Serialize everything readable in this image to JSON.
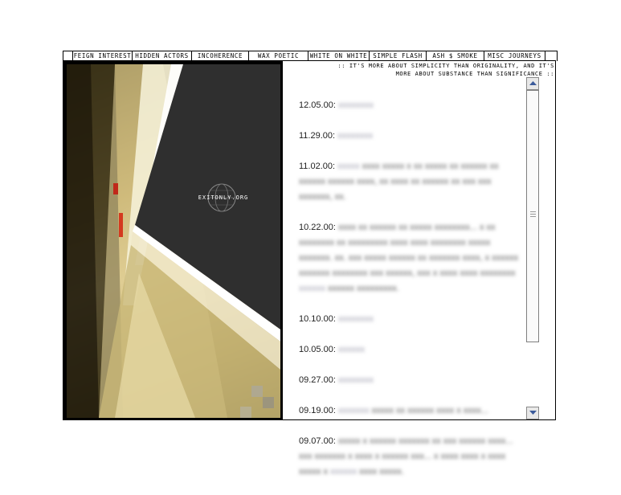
{
  "nav": {
    "tabs": [
      {
        "label": "FEIGN INTEREST"
      },
      {
        "label": "HIDDEN ACTORS"
      },
      {
        "label": "INCOHERENCE"
      },
      {
        "label": "WAX POETIC"
      },
      {
        "label": "WHITE ON WHITE"
      },
      {
        "label": "SIMPLE FLASH"
      },
      {
        "label": "ASH $ SMOKE"
      },
      {
        "label": "MISC JOURNEYS"
      }
    ]
  },
  "photo": {
    "logo_text": "EXITONLY.ORG"
  },
  "tagline": {
    "line1": ":: IT'S MORE ABOUT SIMPLICITY THAN ORIGINALITY, AND IT'S",
    "line2": "MORE ABOUT SUBSTANCE THAN SIGNIFICANCE ::"
  },
  "entries": [
    {
      "date": "12.05.00:"
    },
    {
      "date": "11.29.00:"
    },
    {
      "date": "11.02.00:"
    },
    {
      "date": "10.22.00:"
    },
    {
      "date": "10.10.00:"
    },
    {
      "date": "10.05.00:"
    },
    {
      "date": "09.27.00:"
    },
    {
      "date": "09.19.00:"
    },
    {
      "date": "09.07.00:"
    }
  ],
  "colors": {
    "accent": "#000000",
    "link": "#9999aa"
  }
}
